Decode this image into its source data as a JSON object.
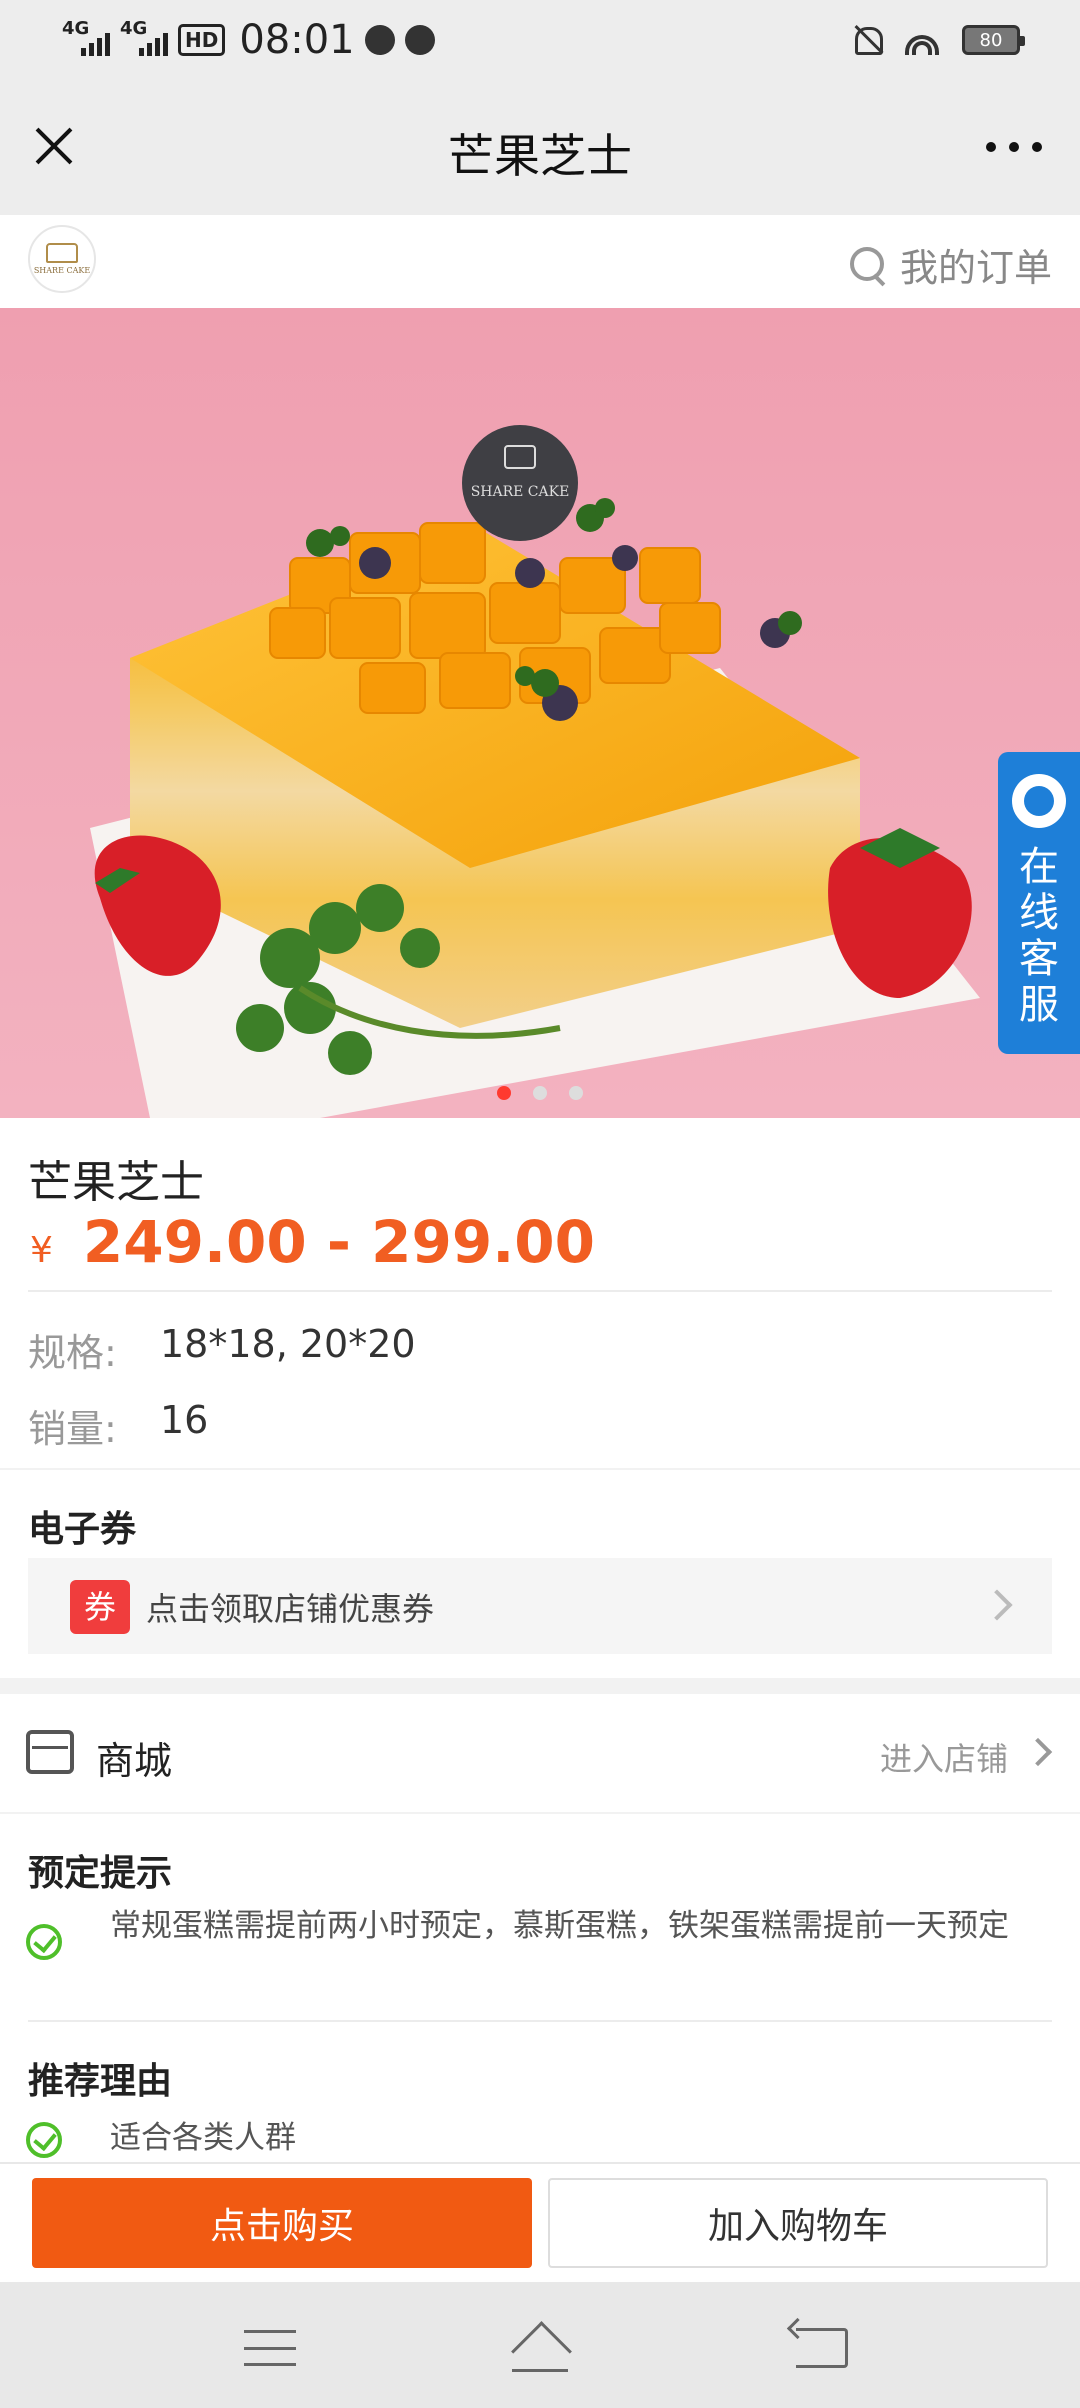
{
  "status_bar": {
    "signal1": "4G",
    "signal2": "4G",
    "hd": "HD",
    "time": "08:01",
    "battery": "80"
  },
  "title_bar": {
    "title": "芒果芝士"
  },
  "shop_header": {
    "logo_text": "SHARE CAKE",
    "my_orders": "我的订单"
  },
  "hero": {
    "topper_text": "SHARE CAKE",
    "service_label": "在线客服",
    "slide_count": 3,
    "active_slide": 1
  },
  "product": {
    "name": "芒果芝士",
    "currency": "¥",
    "price_range": "249.00 - 299.00",
    "spec_label": "规格:",
    "spec_value": "18*18, 20*20",
    "sales_label": "销量:",
    "sales_value": "16"
  },
  "coupon": {
    "section_title": "电子券",
    "tag": "券",
    "text": "点击领取店铺优惠券"
  },
  "mall": {
    "label": "商城",
    "enter": "进入店铺"
  },
  "tips": {
    "booking_title": "预定提示",
    "booking_text": "常规蛋糕需提前两小时预定，慕斯蛋糕，铁架蛋糕需提前一天预定",
    "reason_title": "推荐理由",
    "reason_text": "适合各类人群"
  },
  "actions": {
    "buy": "点击购买",
    "cart": "加入购物车"
  },
  "colors": {
    "accent": "#f15a12",
    "price": "#f15e22",
    "service": "#1e7fd8",
    "coupon_tag": "#f03d3d",
    "check": "#4fbf2a"
  }
}
